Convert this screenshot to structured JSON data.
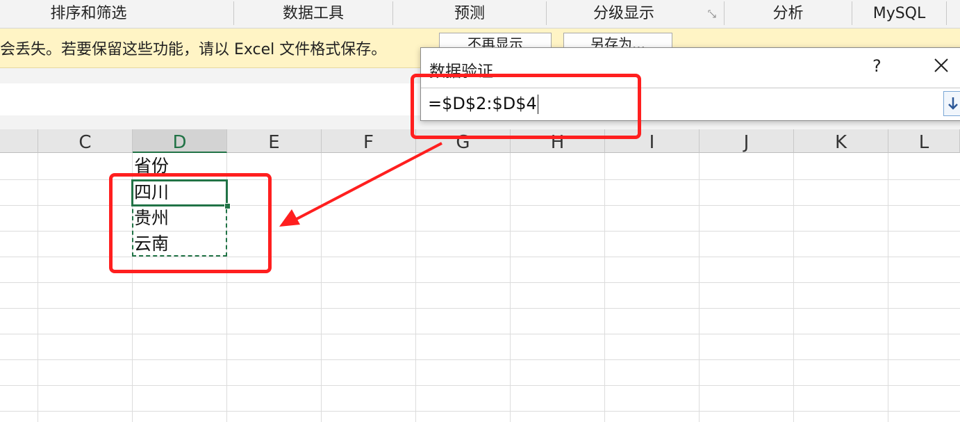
{
  "ribbon": {
    "groups": [
      {
        "label": "排序和筛选"
      },
      {
        "label": "数据工具"
      },
      {
        "label": "预测"
      },
      {
        "label": "分级显示"
      },
      {
        "label": "分析"
      },
      {
        "label": "MySQL"
      }
    ]
  },
  "message_bar": {
    "text": "会丢失。若要保留这些功能，请以 Excel 文件格式保存。",
    "dont_show_again": "不再显示",
    "save_as": "另存为..."
  },
  "grid": {
    "columns": [
      "C",
      "D",
      "E",
      "F",
      "G",
      "H",
      "I",
      "J",
      "K",
      "L"
    ],
    "selected_column": "D",
    "cells": {
      "D1": "省份",
      "D2": "四川",
      "D3": "贵州",
      "D4": "云南"
    }
  },
  "dialog": {
    "title": "数据验证",
    "help": "?",
    "close_icon": "close-icon",
    "formula": "=$D$2:$D$4",
    "collapse_icon": "expand-dialog-icon"
  },
  "colors": {
    "excel_green": "#217346",
    "annotation_red": "#ff1f1f",
    "message_bar_bg": "#fff4c5"
  }
}
